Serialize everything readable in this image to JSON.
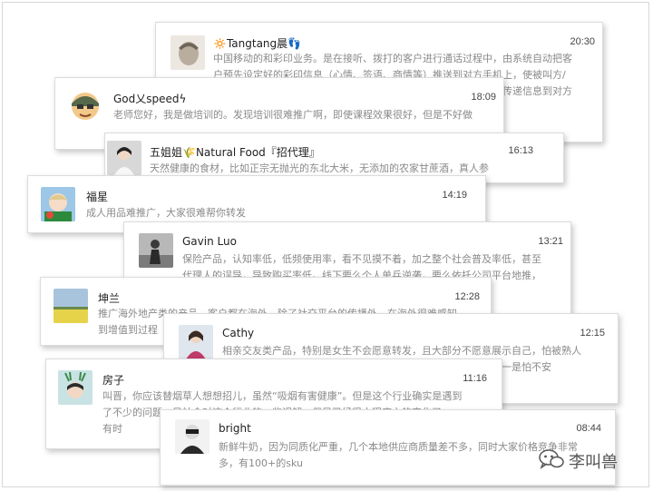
{
  "messages": [
    {
      "name": "🔅Tangtang晨👣",
      "time": "20:30",
      "text": "中国移动的和彩印业务。是在接听、拨打的客户进行通话过程中，由系统自动把客户预先设定好的彩印信息（心情、签语、商情等）推送到对方手机上，使被叫方/主叫方在接听电话的同时，能看到对方所传递的心情、签语、商情传递信息到对方手机屏幕，所"
    },
    {
      "name": "God乂speedϟ",
      "time": "18:09",
      "text": "老师您好，我是做培训的。发现培训很难推广啊，即使课程效果很好，但是不好做"
    },
    {
      "name": "五姐姐🌾Natural Food『招代理』",
      "time": "16:13",
      "text": "天然健康的食材，比如正宗无抛光的东北大米，无添加的农家甘蔗酒，真人参"
    },
    {
      "name": "福星",
      "time": "14:19",
      "text": "成人用品难推广，大家很难帮你转发"
    },
    {
      "name": "Gavin Luo",
      "time": "13:21",
      "text": "保险产品，认知率低，低频使用率，看不见摸不着，加之整个社会普及率低，甚至代理人的误导，导致购买率低。线下要么个人单兵逆袭，要么依托公司平台地推，市场领域只能靠外部资源的支撑，比如团购、理财、胃检等）或者"
    },
    {
      "name": "坤兰",
      "time": "12:28",
      "text": "推广海外地产类的产品，客户都在海外，除了社交平台的传播外，在海外很难感知到增值到过程"
    },
    {
      "name": "Cathy",
      "time": "12:15",
      "text": "相亲交友类产品，特别是女生不会愿意转发，且大部分不愿意展示自己，怕被熟人看到，就算是熟人介绍也容易尴尬，所以推广起来比较难，女生一是怕不安"
    },
    {
      "name": "房子",
      "time": "11:16",
      "text": "叫晋，你应该替烟草人想想招儿，虽然“吸烟有害健康”。但是这个行业确实是遇到了不少的问题，是社会对这个行业的一些误解，但是已经很大程度上的变化了…… 有时"
    },
    {
      "name": "bright",
      "time": "08:44",
      "text": "新鲜牛奶，因为同质化严重，几个本地供应商质量差不多，同时大家价格竞争非常多，有100+的sku"
    }
  ],
  "watermark": {
    "text": "李叫兽",
    "icon": "wechat-icon"
  }
}
